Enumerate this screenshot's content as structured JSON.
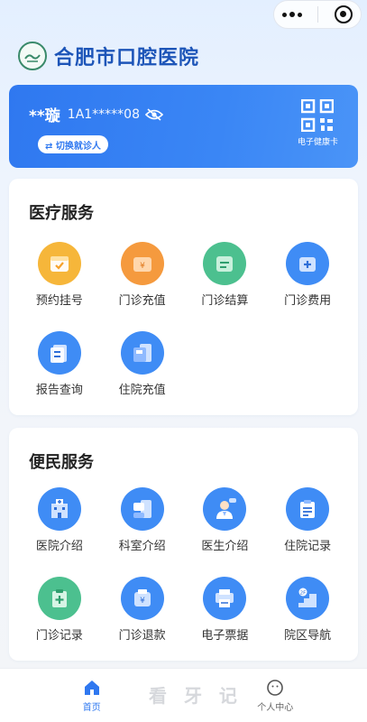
{
  "header": {
    "title": "合肥市口腔医院"
  },
  "patient_card": {
    "name": "**璇",
    "card_no": "1A1*****08",
    "switch_label": "⇄ 切换就诊人",
    "qr_label": "电子健康卡"
  },
  "medical_services": {
    "title": "医疗服务",
    "items": [
      {
        "label": "预约挂号",
        "icon": "calendar-check-icon",
        "color": "#f6b63a"
      },
      {
        "label": "门诊充值",
        "icon": "wallet-yuan-icon",
        "color": "#f59a3e"
      },
      {
        "label": "门诊结算",
        "icon": "receipt-icon",
        "color": "#4cc08f"
      },
      {
        "label": "门诊费用",
        "icon": "plus-box-icon",
        "color": "#3f8cf5"
      },
      {
        "label": "报告查询",
        "icon": "document-icon",
        "color": "#3f8cf5"
      },
      {
        "label": "住院充值",
        "icon": "card-stack-icon",
        "color": "#3f8cf5"
      }
    ]
  },
  "convenience_services": {
    "title": "便民服务",
    "items": [
      {
        "label": "医院介绍",
        "icon": "hospital-building-icon",
        "color": "#3f8cf5"
      },
      {
        "label": "科室介绍",
        "icon": "department-icon",
        "color": "#3f8cf5"
      },
      {
        "label": "医生介绍",
        "icon": "doctor-icon",
        "color": "#3f8cf5"
      },
      {
        "label": "住院记录",
        "icon": "clipboard-list-icon",
        "color": "#3f8cf5"
      },
      {
        "label": "门诊记录",
        "icon": "clipboard-plus-icon",
        "color": "#4cc08f"
      },
      {
        "label": "门诊退款",
        "icon": "refund-yuan-icon",
        "color": "#3f8cf5"
      },
      {
        "label": "电子票据",
        "icon": "printer-icon",
        "color": "#3f8cf5"
      },
      {
        "label": "院区导航",
        "icon": "floor-stairs-icon",
        "color": "#3f8cf5"
      }
    ]
  },
  "bottom_nav": {
    "home_label": "首页",
    "profile_label": "个人中心"
  },
  "watermark": "看 牙 记"
}
